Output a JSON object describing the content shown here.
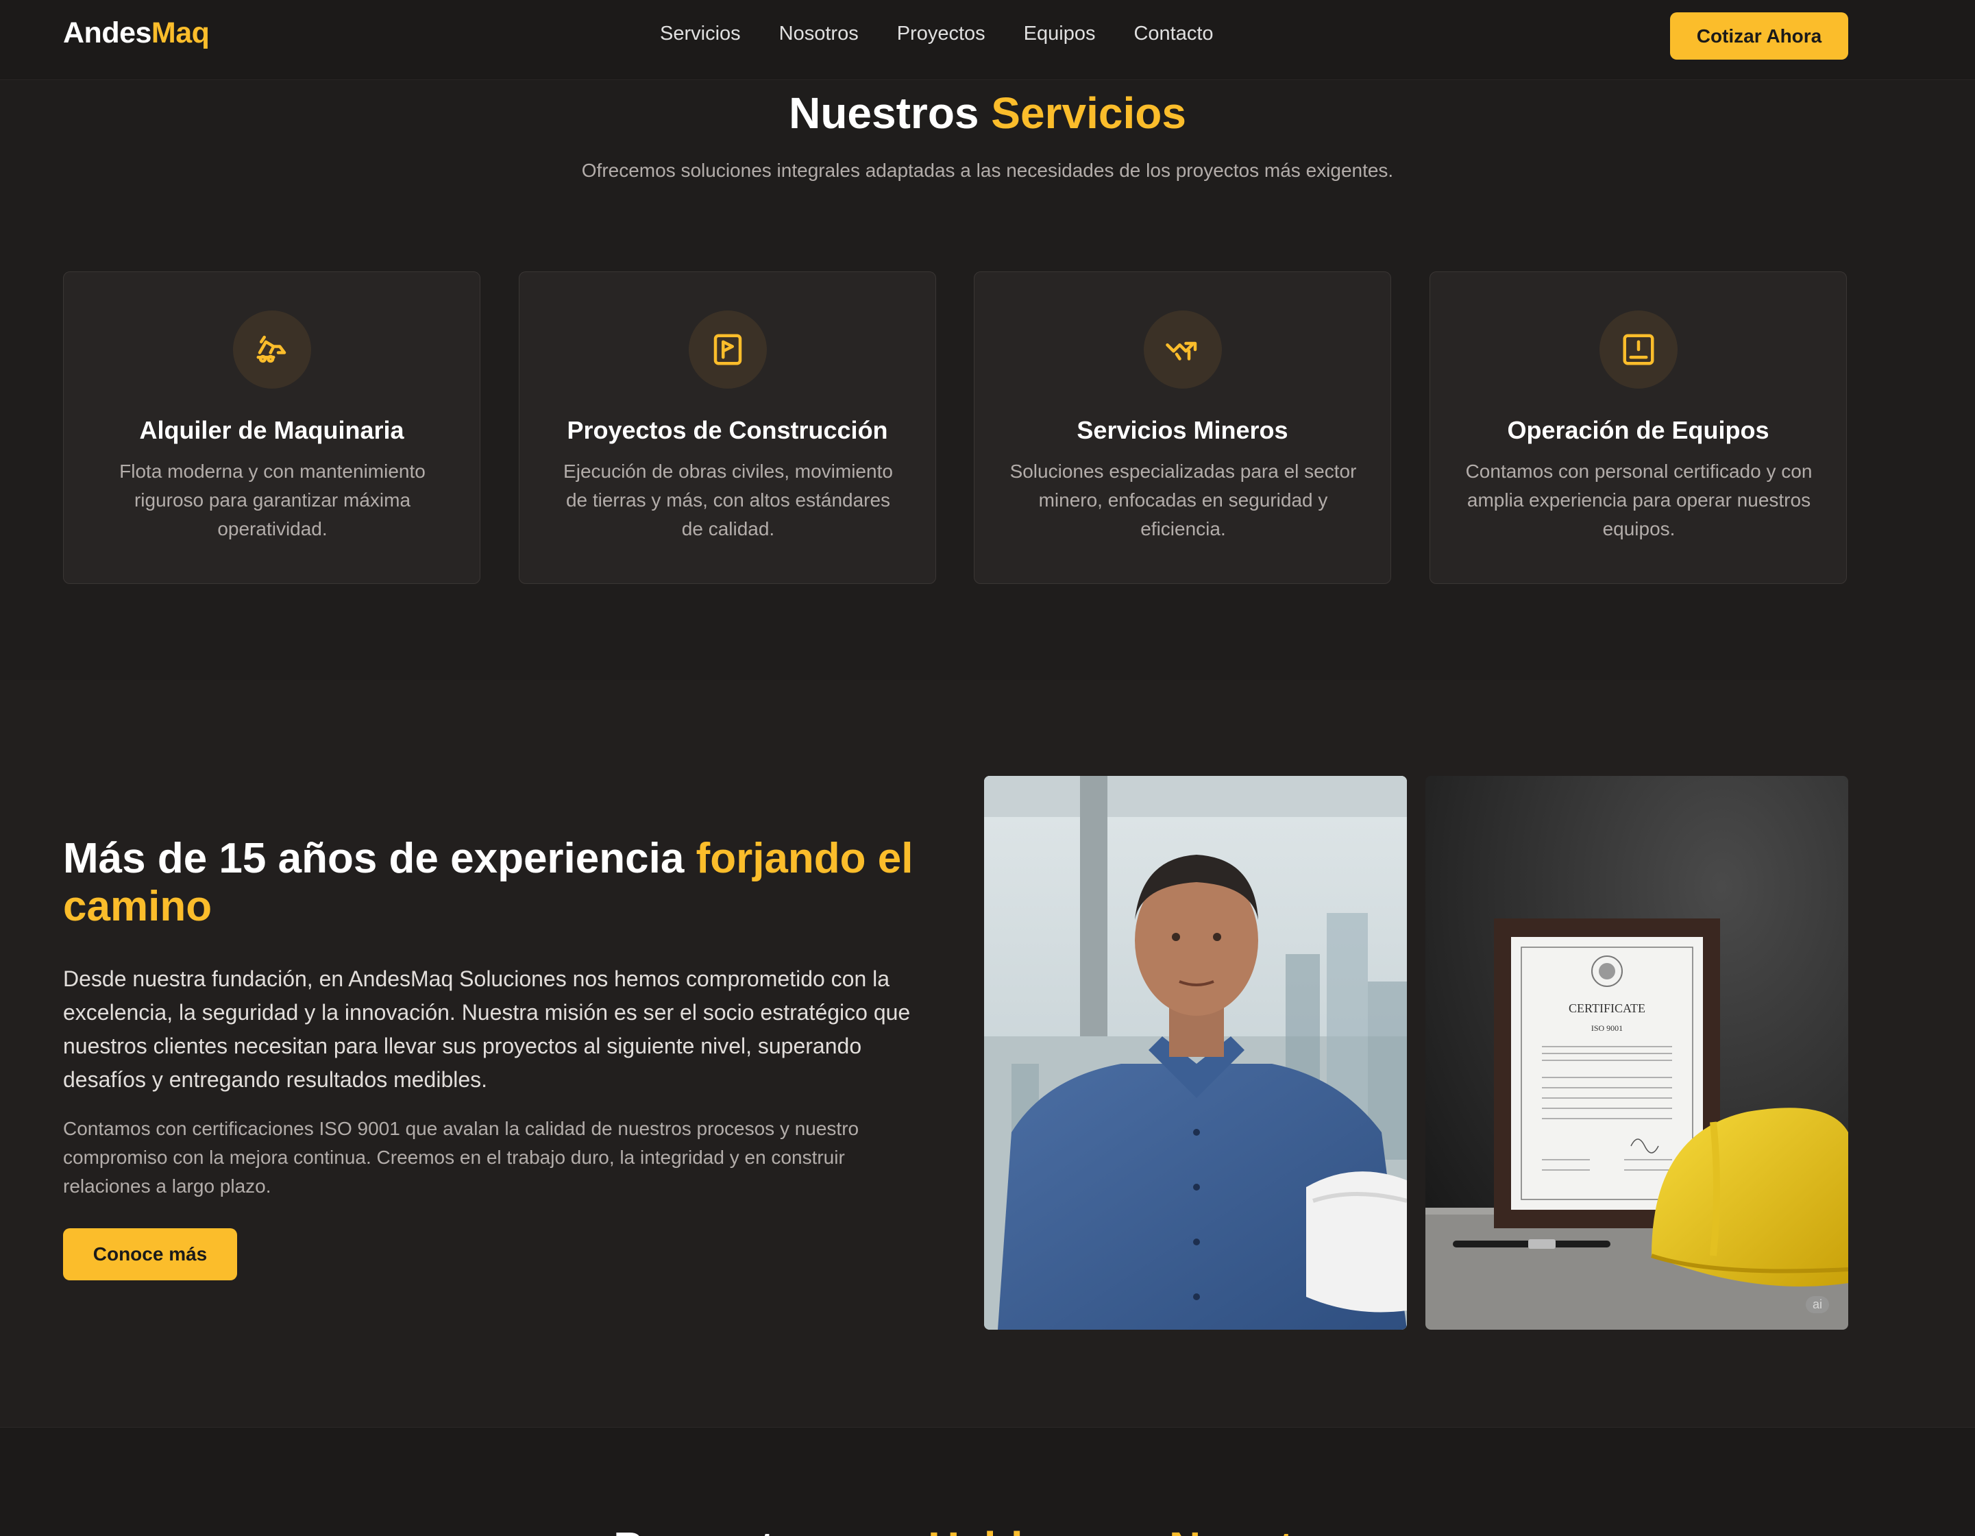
{
  "brand": {
    "name_part1": "Andes",
    "name_part2": "Maq"
  },
  "nav": [
    "Servicios",
    "Nosotros",
    "Proyectos",
    "Equipos",
    "Contacto"
  ],
  "header_cta": "Cotizar Ahora",
  "services": {
    "title_part1": "Nuestros",
    "title_part2": "Servicios",
    "subtitle": "Ofrecemos soluciones integrales adaptadas a las necesidades de los proyectos más exigentes.",
    "cards": [
      {
        "icon": "excavator-icon",
        "title": "Alquiler de Maquinaria",
        "desc": "Flota moderna y con mantenimiento riguroso para garantizar máxima operatividad."
      },
      {
        "icon": "blueprint-icon",
        "title": "Proyectos de Construcción",
        "desc": "Ejecución de obras civiles, movimiento de tierras y más, con altos estándares de calidad."
      },
      {
        "icon": "mining-icon",
        "title": "Servicios Mineros",
        "desc": "Soluciones especializadas para el sector minero, enfocadas en seguridad y eficiencia."
      },
      {
        "icon": "operator-icon",
        "title": "Operación de Equipos",
        "desc": "Contamos con personal certificado y con amplia experiencia para operar nuestros equipos."
      }
    ]
  },
  "about": {
    "title_part1": "Más de 15 años de experiencia",
    "title_part2": "forjando el camino",
    "paragraph1": "Desde nuestra fundación, en AndesMaq Soluciones nos hemos comprometido con la excelencia, la seguridad y la innovación. Nuestra misión es ser el socio estratégico que nuestros clientes necesitan para llevar sus proyectos al siguiente nivel, superando desafíos y entregando resultados medibles.",
    "paragraph2": "Contamos con certificaciones ISO 9001 que avalan la calidad de nuestros procesos y nuestro compromiso con la mejora continua. Creemos en el trabajo duro, la integridad y en construir relaciones a largo plazo.",
    "button": "Conoce más",
    "certificate_heading": "CERTIFICATE",
    "certificate_standard": "ISO 9001",
    "ai_badge": "ai"
  },
  "next_section": {
    "title_part1": "Proyectos que",
    "title_part2": "Hablan por Nosotros"
  },
  "colors": {
    "accent": "#fbbd2b",
    "background": "#1c1a19",
    "card": "#282524"
  }
}
